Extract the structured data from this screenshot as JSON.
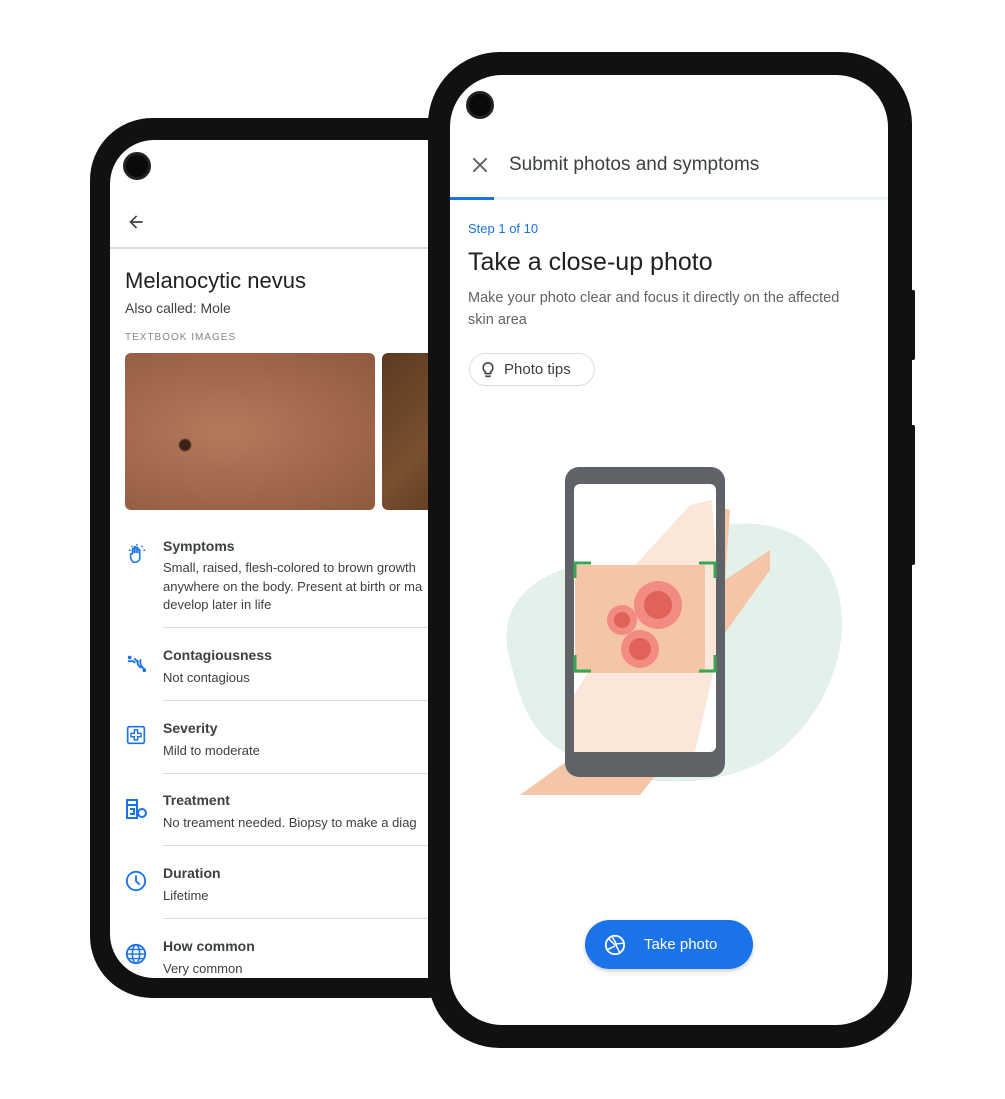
{
  "back_screen": {
    "title": "Melanocytic nevus",
    "subtitle": "Also called: Mole",
    "section_label": "TEXTBOOK IMAGES",
    "items": [
      {
        "icon": "hand-icon",
        "title": "Symptoms",
        "lines": [
          "Small, raised, flesh-colored to brown growth",
          "anywhere on the body. Present at birth or ma",
          "develop later in life"
        ]
      },
      {
        "icon": "contagion-icon",
        "title": "Contagiousness",
        "lines": [
          "Not contagious"
        ]
      },
      {
        "icon": "medical-plus-icon",
        "title": "Severity",
        "lines": [
          "Mild to moderate"
        ]
      },
      {
        "icon": "medication-icon",
        "title": "Treatment",
        "lines": [
          "No treament needed. Biopsy to make a diag"
        ]
      },
      {
        "icon": "clock-icon",
        "title": "Duration",
        "lines": [
          "Lifetime"
        ]
      },
      {
        "icon": "globe-icon",
        "title": "How common",
        "lines": [
          "Very common"
        ]
      }
    ]
  },
  "front_screen": {
    "header_title": "Submit photos and symptoms",
    "progress": 0.1,
    "step": "Step 1 of 10",
    "heading": "Take a close-up photo",
    "description_lines": [
      "Make your photo clear and focus it directly on the affected",
      "skin area"
    ],
    "tips_button": "Photo tips",
    "take_photo_button": "Take photo"
  },
  "colors": {
    "accent": "#1a73e8",
    "progress_track": "#e8f0fe",
    "illustration_green": "#e3f1ea",
    "frame_green": "#34a853"
  }
}
